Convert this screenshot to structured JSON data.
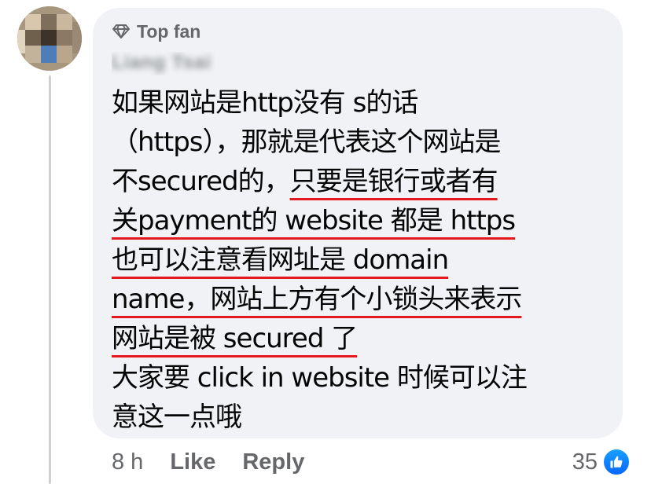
{
  "comment": {
    "badge_icon": "diamond-icon",
    "badge_label": "Top fan",
    "author_name": "Liang Tsai",
    "lines": [
      "如果网站是http没有 s的话",
      "（https），那就是代表这个网站是",
      "不secured的，",
      "只要是银行或者有",
      "关payment的 website 都是 https",
      "也可以注意看网址是 domain",
      "name，网站上方有个小锁头来表示",
      "网站是被 secured 了",
      "大家要 click in website 时候可以注",
      "意这一点哦"
    ]
  },
  "actions": {
    "time": "8 h",
    "like": "Like",
    "reply": "Reply"
  },
  "reactions": {
    "count": "35",
    "icon": "thumbs-up-icon",
    "color": "#0866ff"
  },
  "colors": {
    "bubble": "#f0f2f5",
    "underline": "#e4191e",
    "muted": "#65676b"
  }
}
